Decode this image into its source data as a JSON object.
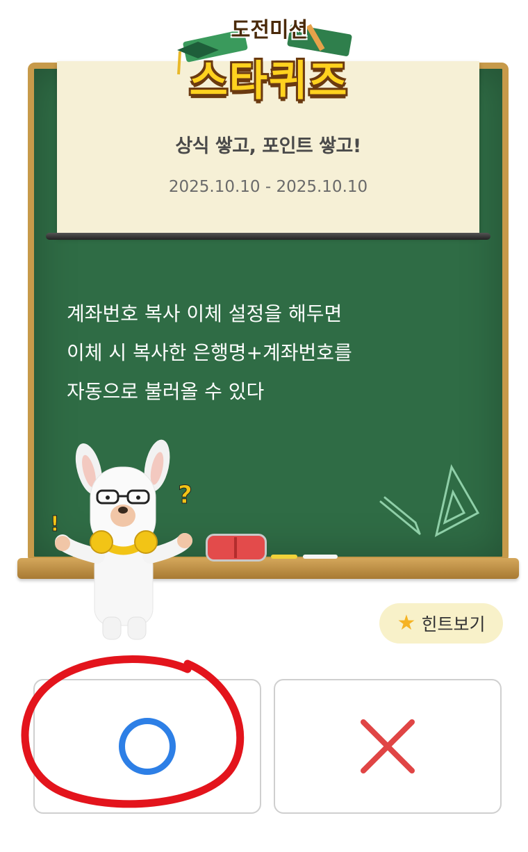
{
  "logo": {
    "top_text": "도전미션",
    "main_text": "스타퀴즈"
  },
  "banner": {
    "subtitle": "상식 쌓고, 포인트 쌓고!",
    "dates": "2025.10.10 - 2025.10.10"
  },
  "question": {
    "lines": [
      "계좌번호 복사 이체 설정을 해두면",
      "이체 시 복사한 은행명+계좌번호를",
      "자동으로 불러올 수 있다"
    ]
  },
  "character": {
    "exclaim": "!",
    "question_mark": "?"
  },
  "hint": {
    "label": "힌트보기",
    "icon": "star-icon"
  },
  "answers": {
    "o_icon": "circle-o-icon",
    "x_icon": "cross-x-icon"
  },
  "colors": {
    "board": "#2f6c45",
    "frame": "#c79a4a",
    "banner": "#f6f0d6",
    "o_blue": "#2d7fe6",
    "x_red": "#e04545",
    "annotation_red": "#e3141c",
    "hint_bg": "#f8f1c9"
  }
}
